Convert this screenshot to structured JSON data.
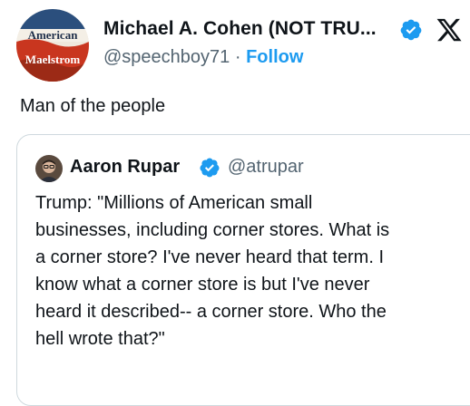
{
  "author": {
    "name": "Michael A. Cohen (NOT TRU...",
    "handle": "@speechboy71",
    "separator": "·",
    "follow_label": "Follow",
    "avatar_text_top": "American",
    "avatar_text_bottom": "Maelstrom",
    "verified": true
  },
  "brand": {
    "logo": "x-logo-icon"
  },
  "tweet": {
    "text": "Man of the people"
  },
  "quote": {
    "name": "Aaron Rupar",
    "handle": "@atrupar",
    "verified": true,
    "text": "Trump: \"Millions of American small\nbusinesses, including corner stores. What is\na corner store? I've never heard that term. I\nknow what a corner store is but I've never\nheard it described-- a corner store. Who the\nhell wrote that?\""
  },
  "colors": {
    "accent": "#1d9bf0",
    "secondary_text": "#536471",
    "border": "#cfd9de",
    "primary_text": "#0f1419"
  }
}
